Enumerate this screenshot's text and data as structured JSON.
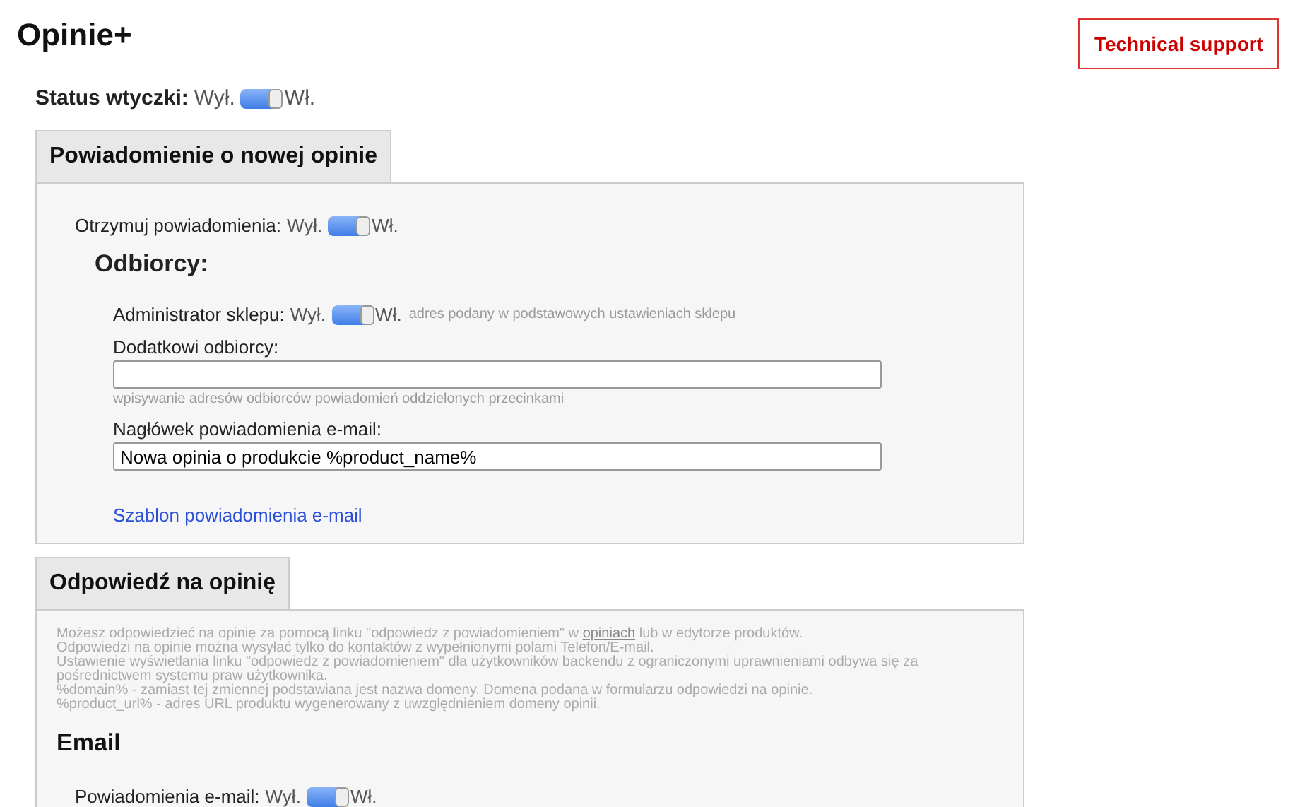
{
  "title": "Opinie+",
  "support_button": "Technical support",
  "plugin_status": {
    "label": "Status wtyczki:",
    "off_label": "Wył.",
    "on_label": "Wł.",
    "on": true
  },
  "sections": [
    {
      "tab": "Powiadomienie o nowej opinie",
      "kind": "notify",
      "toggle": {
        "label": "Otrzymuj powiadomienia:",
        "off_label": "Wył.",
        "on_label": "Wł.",
        "on": true
      },
      "recipients_heading": "Odbiorcy:",
      "admin_toggle": {
        "label": "Administrator sklepu:",
        "off_label": "Wył.",
        "on_label": "Wł.",
        "on": true,
        "hint": "adres podany w podstawowych ustawieniach sklepu"
      },
      "extra_recipients": {
        "label": "Dodatkowi odbiorcy:",
        "hint": "wpisywanie adresów odbiorców powiadomień oddzielonych przecinkami"
      },
      "email_subject": {
        "label": "Nagłówek powiadomienia e-mail:",
        "value": "Nowa opinia o produkcie %product_name%"
      },
      "template_link": "Szablon powiadomienia e-mail"
    },
    {
      "tab": "Odpowiedź na opinię",
      "kind": "reply",
      "help_first_line": {
        "before": "Możesz odpowiedzieć na opinię za pomocą linku \"odpowiedz z powiadomieniem\" w ",
        "link": "opiniach",
        "after": " lub w edytorze produktów."
      },
      "help_lines": [
        "Odpowiedzi na opinie można wysyłać tylko do kontaktów z wypełnionymi polami Telefon/E-mail.",
        "Ustawienie wyświetlania linku \"odpowiedz z powiadomieniem\" dla użytkowników backendu z ograniczonymi uprawnieniami odbywa się za pośrednictwem systemu praw użytkownika.",
        "%domain% - zamiast tej zmiennej podstawiana jest nazwa domeny. Domena podana w formularzu odpowiedzi na opinie.",
        "%product_url% - adres URL produktu wygenerowany z uwzględnieniem domeny opinii."
      ],
      "email_heading": "Email",
      "toggle": {
        "label": "Powiadomienia e-mail:",
        "off_label": "Wył.",
        "on_label": "Wł.",
        "on": true
      }
    }
  ]
}
